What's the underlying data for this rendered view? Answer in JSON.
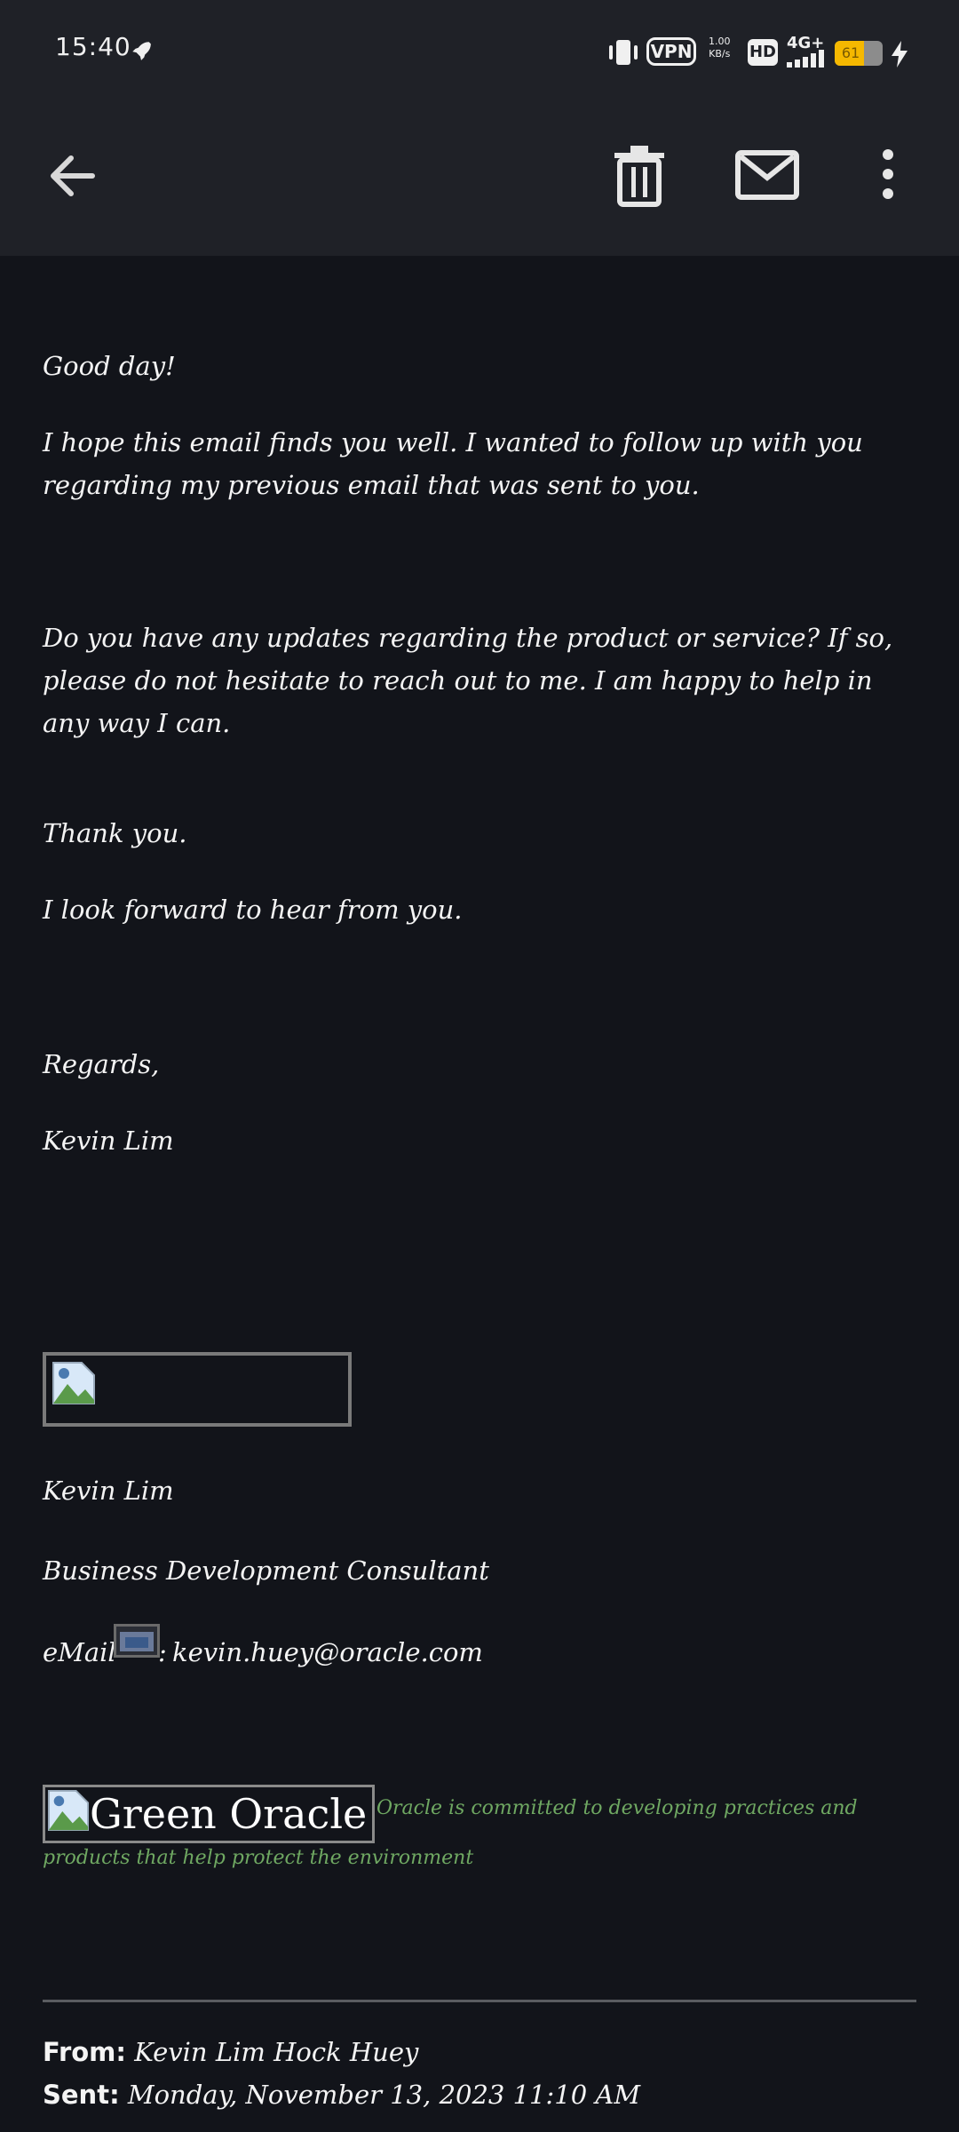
{
  "status_bar": {
    "time": "15:40",
    "vpn_label": "VPN",
    "net_speed_value": "1.00",
    "net_speed_unit": "KB/s",
    "hd_label": "HD",
    "net_type": "4G+",
    "battery_level": "61",
    "battery_fraction": 0.61
  },
  "app_bar": {
    "icons": [
      "back-arrow-icon",
      "delete-icon",
      "mail-icon",
      "more-vert-icon"
    ]
  },
  "email": {
    "greeting": "Good day!",
    "paragraph1": "I hope this email finds you well. I wanted to follow up with you regarding my previous email that was sent to you.",
    "paragraph2": "Do you have any updates regarding the product or service? If so, please do not hesitate to reach out to me. I am happy to help in any way I can.",
    "thanks": "Thank you.",
    "look_forward": "I look forward to hear from you.",
    "regards": "Regards,",
    "sender_name": "Kevin Lim"
  },
  "signature": {
    "name": "Kevin Lim",
    "title": "Business Development Consultant",
    "email_label": "eMail",
    "email_separator": ":",
    "email_address": "kevin.huey@oracle.com",
    "green_oracle_alt": "Green Oracle",
    "green_statement": "Oracle is committed to developing practices and products that help protect the environment"
  },
  "quoted_header": {
    "from_label": "From:",
    "from_value": "Kevin Lim Hock Huey",
    "sent_label": "Sent:",
    "sent_value": "Monday, November 13, 2023 11:10 AM"
  },
  "colors": {
    "background": "#12141a",
    "bar_background": "#1f2127",
    "text": "#f4f4f4",
    "green_text": "#6fa862",
    "battery": "#f5b800"
  }
}
